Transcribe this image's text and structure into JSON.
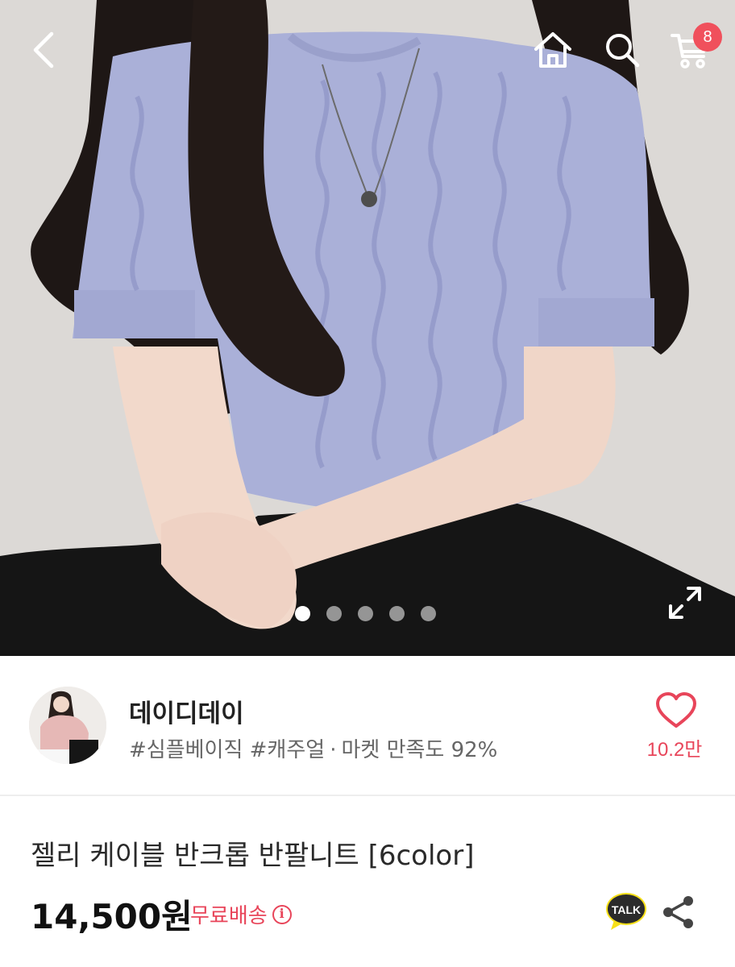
{
  "header": {
    "cart_badge_count": "8",
    "icons": [
      "chevron-left-icon",
      "home-icon",
      "search-icon",
      "cart-icon"
    ]
  },
  "gallery": {
    "dot_count": 5,
    "active_index": 0,
    "expand_icon": "expand-icon",
    "image_description_colors": {
      "sweater": "#aab0d8",
      "hair": "#1c1614",
      "skin": "#f0d6c8",
      "pants": "#141414",
      "wall": "#dedbd8"
    }
  },
  "shop": {
    "name": "데이디데이",
    "tags": "#심플베이직 #캐주얼",
    "separator": "·",
    "satisfaction": "마켓 만족도 92%",
    "like_count": "10.2만"
  },
  "product": {
    "title": "젤리 케이블 반크롭 반팔니트 [6color]",
    "price": "14,500원",
    "shipping": "무료배송",
    "talk_label": "TALK"
  },
  "colors": {
    "accent": "#e8455a",
    "badge": "#f0505c",
    "talk_yellow": "#f7e018"
  }
}
